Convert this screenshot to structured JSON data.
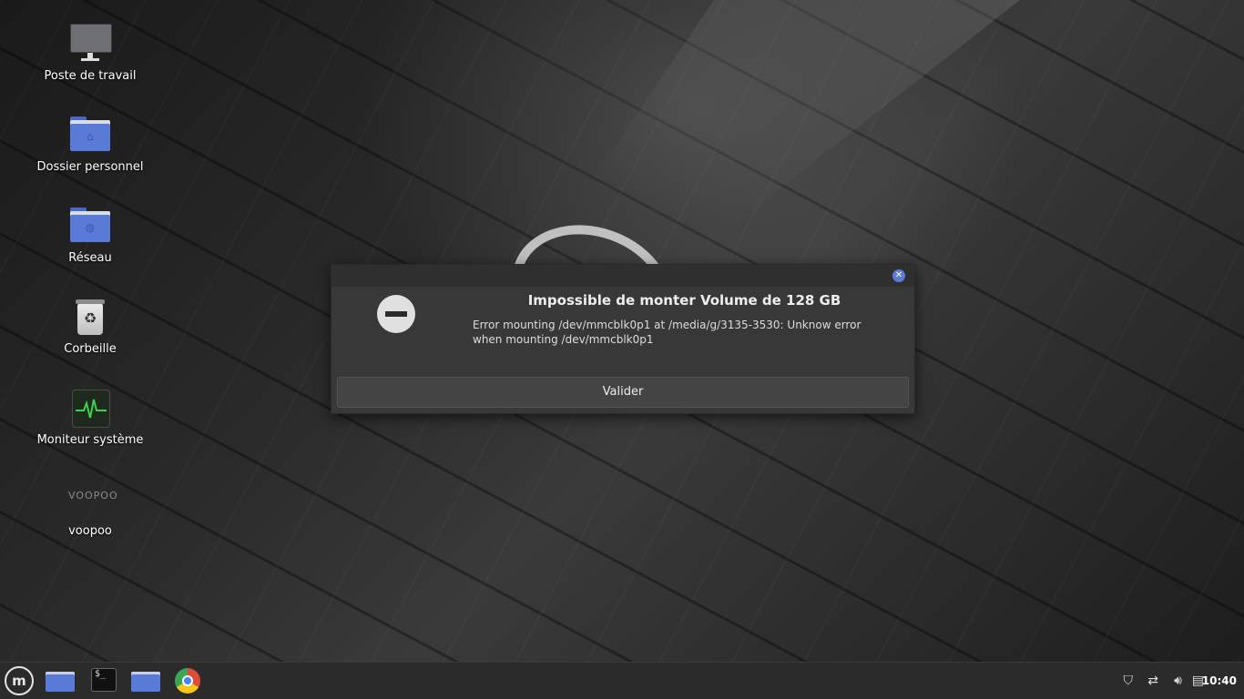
{
  "desktop": {
    "icons": [
      {
        "label": "Poste de travail",
        "icon": "computer-icon"
      },
      {
        "label": "Dossier personnel",
        "icon": "home-folder-icon"
      },
      {
        "label": "Réseau",
        "icon": "network-folder-icon"
      },
      {
        "label": "Corbeille",
        "icon": "trash-icon"
      },
      {
        "label": "Moniteur système",
        "icon": "system-monitor-icon"
      },
      {
        "label": "voopoo",
        "icon": "voopoo-icon",
        "logo_text": "VOOPOO"
      }
    ]
  },
  "dialog": {
    "title": "Impossible de monter Volume de 128 GB",
    "message": "Error mounting /dev/mmcblk0p1 at /media/g/3135-3530: Unknow error when mounting /dev/mmcblk0p1",
    "button_label": "Valider",
    "close_glyph": "✕"
  },
  "taskbar": {
    "menu_glyph": "m",
    "terminal_text": "$_",
    "clock": "10:40"
  },
  "colors": {
    "accent": "#5a7ad8",
    "dialog_bg": "#383838",
    "taskbar_bg": "#2b2b2b"
  }
}
